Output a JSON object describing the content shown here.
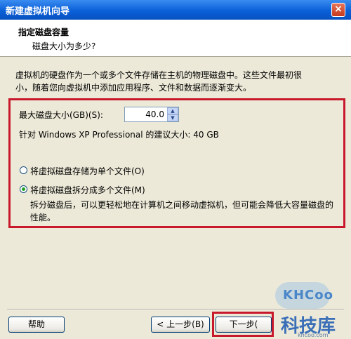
{
  "window": {
    "title": "新建虚拟机向导",
    "close_glyph": "×"
  },
  "header": {
    "title": "指定磁盘容量",
    "subtitle": "磁盘大小为多少?"
  },
  "intro_line1": "虚拟机的硬盘作为一个或多个文件存储在主机的物理磁盘中。这些文件最初很",
  "intro_line2": "小，随着您向虚拟机中添加应用程序、文件和数据而逐渐变大。",
  "disk_size": {
    "label": "最大磁盘大小(GB)(S):",
    "value": "40.0",
    "recommended": "针对 Windows XP Professional 的建议大小: 40 GB"
  },
  "options": [
    {
      "label": "将虚拟磁盘存储为单个文件(O)",
      "selected": false
    },
    {
      "label": "将虚拟磁盘拆分成多个文件(M)",
      "selected": true
    }
  ],
  "split_desc_line1": "拆分磁盘后，可以更轻松地在计算机之间移动虚拟机，但可能会降低大容量磁盘的",
  "split_desc_line2": "性能。",
  "buttons": {
    "help": "帮助",
    "back": "< 上一步(B)",
    "next": "下一步("
  },
  "watermark": {
    "logo": "KHCoo",
    "name": "科技库",
    "url": "khcoo.com"
  }
}
